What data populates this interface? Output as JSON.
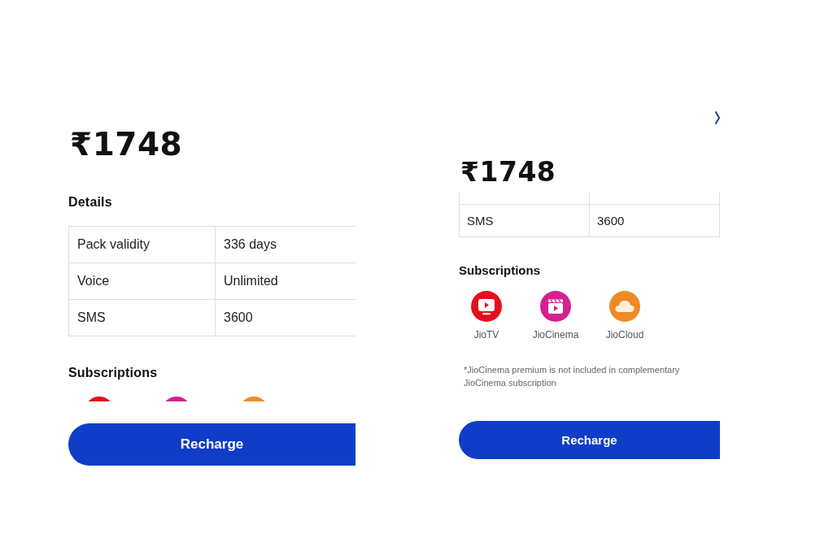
{
  "panels": [
    {
      "kind": "full",
      "price": "₹1748",
      "details": {
        "title": "Details",
        "rows": [
          {
            "label": "Pack validity",
            "value": "336 days"
          },
          {
            "label": "Voice",
            "value": "Unlimited"
          },
          {
            "label": "SMS",
            "value": "3600"
          }
        ]
      },
      "subscriptions": {
        "title": "Subscriptions",
        "apps": [
          {
            "color": "#e3101c"
          },
          {
            "color": "#d4218f"
          },
          {
            "color": "#f08a24"
          }
        ]
      },
      "button": "Recharge"
    },
    {
      "kind": "scrolled",
      "price": "₹1748",
      "details": {
        "rows": [
          {
            "label": "SMS",
            "value": "3600"
          }
        ]
      },
      "subscriptions": {
        "title": "Subscriptions",
        "apps": [
          {
            "name": "JioTV",
            "color": "#e3101c"
          },
          {
            "name": "JioCinema",
            "color": "#d4218f"
          },
          {
            "name": "JioCloud",
            "color": "#f08a24"
          }
        ],
        "note": "*JioCinema premium is not included in complementary JioCinema subscription"
      },
      "button": "Recharge"
    }
  ]
}
